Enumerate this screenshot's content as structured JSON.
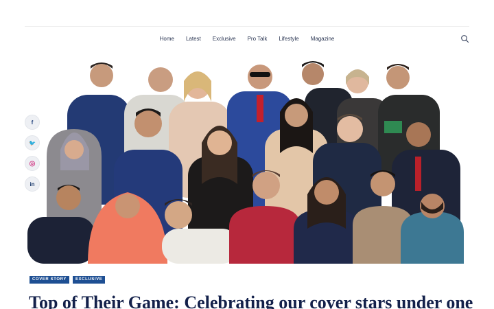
{
  "nav": {
    "items": [
      "Home",
      "Latest",
      "Exclusive",
      "Pro Talk",
      "Lifestyle",
      "Magazine"
    ],
    "search_icon": "search-icon"
  },
  "social": [
    {
      "icon": "facebook-icon",
      "glyph": "f",
      "color": "#1f3f7a"
    },
    {
      "icon": "twitter-icon",
      "glyph": "🐦",
      "color": "#2aa3e6"
    },
    {
      "icon": "instagram-icon",
      "glyph": "◎",
      "color": "#d2458b"
    },
    {
      "icon": "linkedin-icon",
      "glyph": "in",
      "color": "#1d3c6e"
    }
  ],
  "article": {
    "tags": [
      "COVER STORY",
      "EXCLUSIVE"
    ],
    "headline": "Top of Their Game: Celebrating our cover stars under one"
  },
  "colors": {
    "tag_bg": "#1e4f93",
    "headline": "#13204a"
  }
}
